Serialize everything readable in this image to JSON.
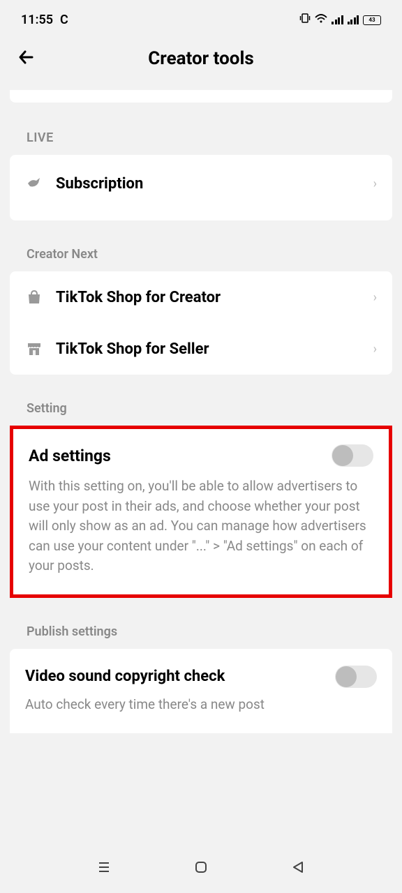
{
  "status": {
    "time": "11:55",
    "indicator": "C",
    "battery": "43"
  },
  "header": {
    "title": "Creator tools"
  },
  "sections": {
    "live": {
      "label": "LIVE",
      "items": [
        {
          "label": "Subscription"
        }
      ]
    },
    "creator_next": {
      "label": "Creator Next",
      "items": [
        {
          "label": "TikTok Shop for Creator"
        },
        {
          "label": "TikTok Shop for Seller"
        }
      ]
    },
    "setting": {
      "label": "Setting",
      "ad": {
        "title": "Ad settings",
        "description": "With this setting on, you'll be able to allow advertisers to use your post in their ads, and choose whether your post will only show as an ad. You can manage how advertisers can use your content under \"...\" > \"Ad settings\" on each of your posts."
      }
    },
    "publish": {
      "label": "Publish settings",
      "item": {
        "title": "Video sound copyright check",
        "description": "Auto check every time there's a new post"
      }
    }
  }
}
